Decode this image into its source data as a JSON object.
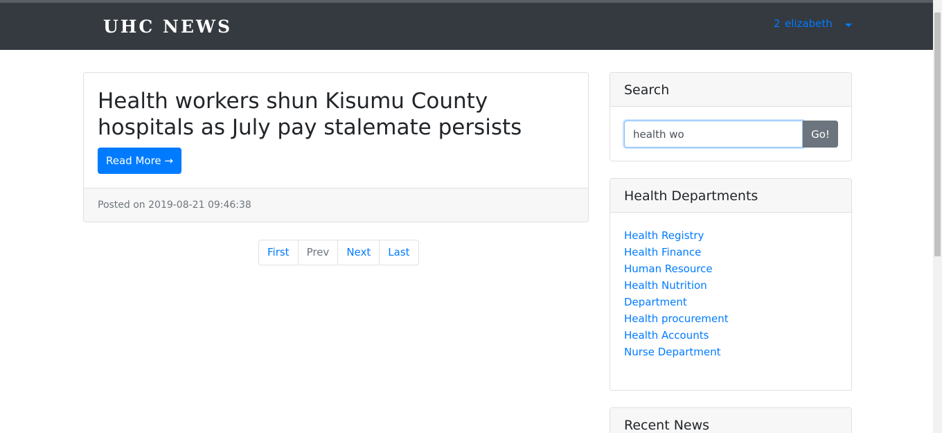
{
  "header": {
    "brand": "UHC NEWS",
    "user_icon": "2",
    "username": "elizabeth"
  },
  "post": {
    "title": "Health workers shun Kisumu County hospitals as July pay stalemate persists",
    "read_more_label": "Read More →",
    "posted_on": "Posted on 2019-08-21 09:46:38"
  },
  "pagination": {
    "first": "First",
    "prev": "Prev",
    "next": "Next",
    "last": "Last"
  },
  "search": {
    "title": "Search",
    "value": "health wo",
    "button": "Go!"
  },
  "departments": {
    "title": "Health Departments",
    "items": [
      "Health Registry",
      "Health Finance",
      "Human Resource",
      "Health Nutrition Department",
      "Health procurement",
      "Health Accounts",
      "Nurse Department"
    ]
  },
  "recent": {
    "title": "Recent News"
  },
  "colors": {
    "navbar": "#343a40",
    "primary": "#007bff",
    "secondary": "#6c757d"
  }
}
